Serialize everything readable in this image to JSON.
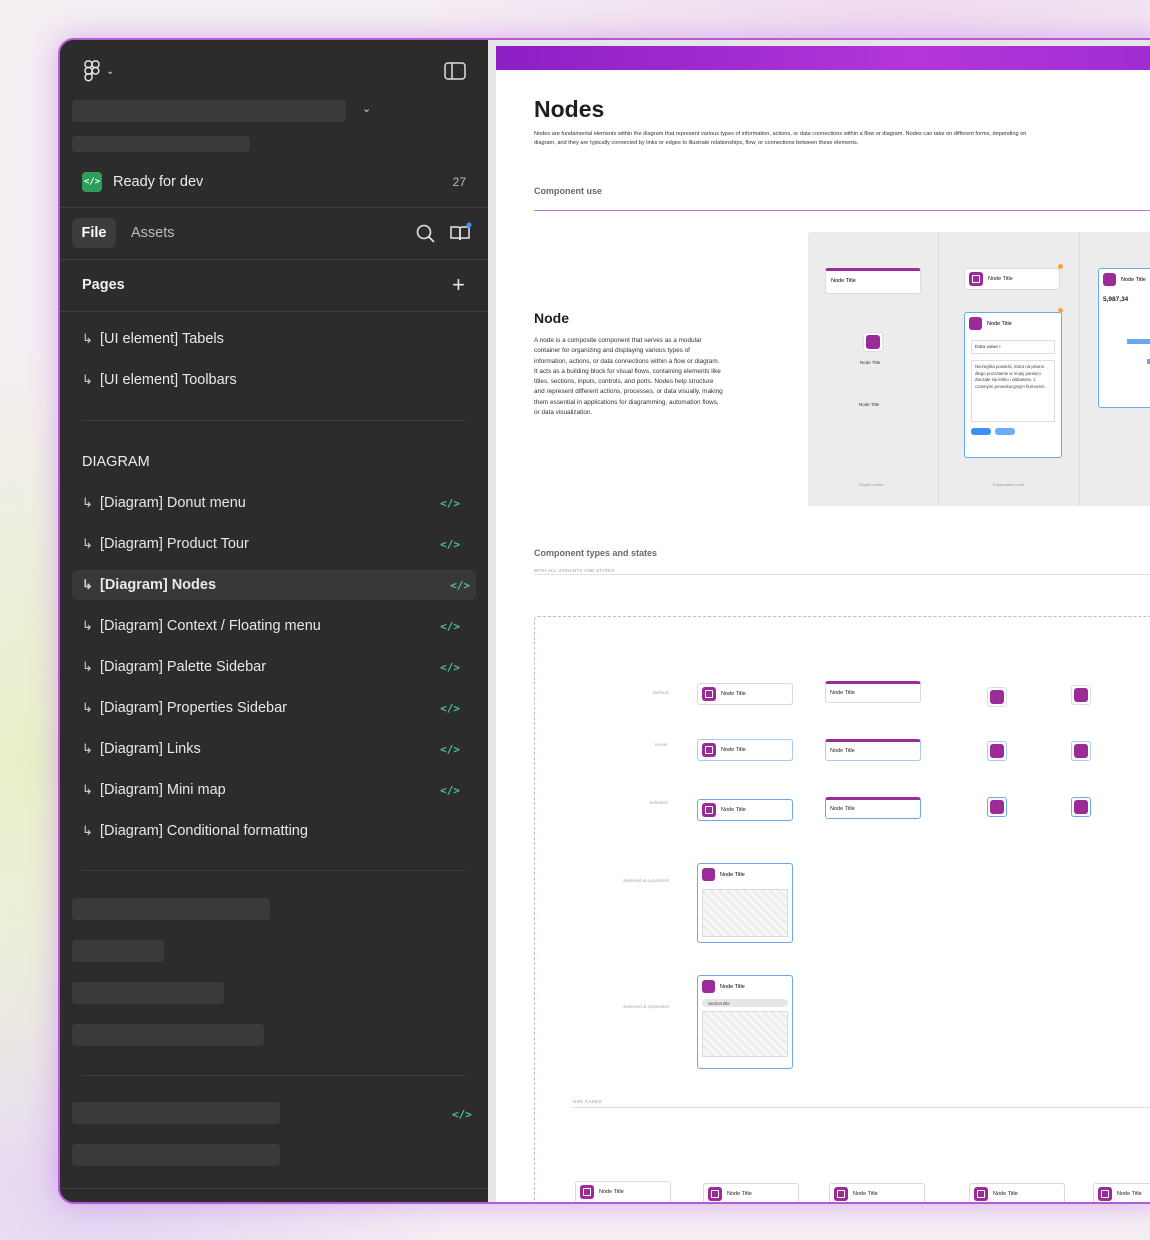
{
  "header": {
    "ready_label": "Ready for dev",
    "ready_count": "27",
    "file_tab": "File",
    "assets_tab": "Assets",
    "pages_label": "Pages"
  },
  "pages": [
    {
      "label": "[UI element] Tabels",
      "code": ""
    },
    {
      "label": "[UI element] Toolbars",
      "code": ""
    }
  ],
  "diagram_section": "DIAGRAM",
  "diagram_pages": [
    {
      "label": "[Diagram] Donut menu",
      "code": "</>"
    },
    {
      "label": "[Diagram] Product Tour",
      "code": "</>"
    },
    {
      "label": "[Diagram] Nodes",
      "code": "</>",
      "active": true
    },
    {
      "label": "[Diagram] Context / Floating menu",
      "code": "</>"
    },
    {
      "label": "[Diagram] Palette Sidebar",
      "code": "</>"
    },
    {
      "label": "[Diagram] Properties Sidebar",
      "code": "</>"
    },
    {
      "label": "[Diagram] Links",
      "code": "</>"
    },
    {
      "label": "[Diagram] Mini map",
      "code": "</>"
    },
    {
      "label": "[Diagram] Conditional formatting",
      "code": ""
    }
  ],
  "bottom_code": "</>",
  "doc": {
    "title": "Nodes",
    "intro": "Nodes are fundamental elements within the diagram that represent various types of information, actions, or data connections within a flow or diagram.  Nodes can take on different forms, depending on",
    "intro2": "diagram, and they are typically connected by links or edges to illustrate relationships, flow, or connections between these elements.",
    "section1": "Component use",
    "node_heading": "Node",
    "node_desc": "A node is a composite component that serves as a modular container for organizing and displaying various types of information, actions, or data connections within a flow or diagram. It acts as a building block for visual flows, containing elements like titles, sections, inputs, controls, and ports. Nodes help structure and represent different actions, processes, or data visually, making them essential in applications for diagramming, automation flows, or data visualization.",
    "section2": "Component types and states",
    "section2_sub": "WITH ALL VARIANTS AND STATES",
    "node_title": "Node Title",
    "node_subtitle": "Node Subtitle",
    "label_simple": "Simple nodes",
    "label_expandable": "Expandable node",
    "data_value": "Data value I",
    "polish_text": "Niezwykła powieść, która na pewno długo pozostanie w mojej pamięci. Zacząłe się lekko i dabawnie, z czasnymi prowokacyjnym humorem.",
    "chart_value": "5,987,34",
    "section_title": "Section title",
    "use_cases": "USE CASES",
    "row_default": "Default",
    "row_hover": "Hover",
    "row_selected": "Selected",
    "row_selected_expanded": "Selected & expanded"
  }
}
